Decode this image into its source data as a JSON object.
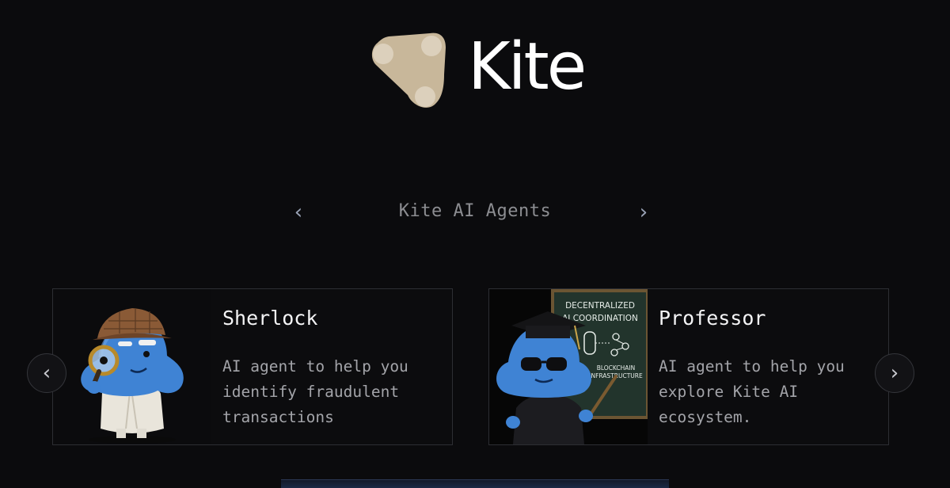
{
  "brand": {
    "name": "Kite",
    "logo_icon": "kite-logo-icon",
    "logo_color": "#c8b79a"
  },
  "section": {
    "title": "Kite AI Agents",
    "prev_icon": "chevron-left-icon",
    "next_icon": "chevron-right-icon",
    "prev": "‹",
    "next": "›"
  },
  "carousel": {
    "prev": "‹",
    "next": "›"
  },
  "agents": [
    {
      "name": "Sherlock",
      "description": "AI agent to help you identify fraudulent transactions",
      "image": "sherlock-mascot-illustration"
    },
    {
      "name": "Professor",
      "description": "AI agent to help you explore Kite AI ecosystem.",
      "image": "professor-mascot-illustration",
      "board_text": [
        "DECENTRALIZED",
        "AI COORDINATION",
        "BLOCKCHAIN",
        "INFRASTRUCTURE"
      ]
    }
  ],
  "accent_color": "#4a8ad8"
}
